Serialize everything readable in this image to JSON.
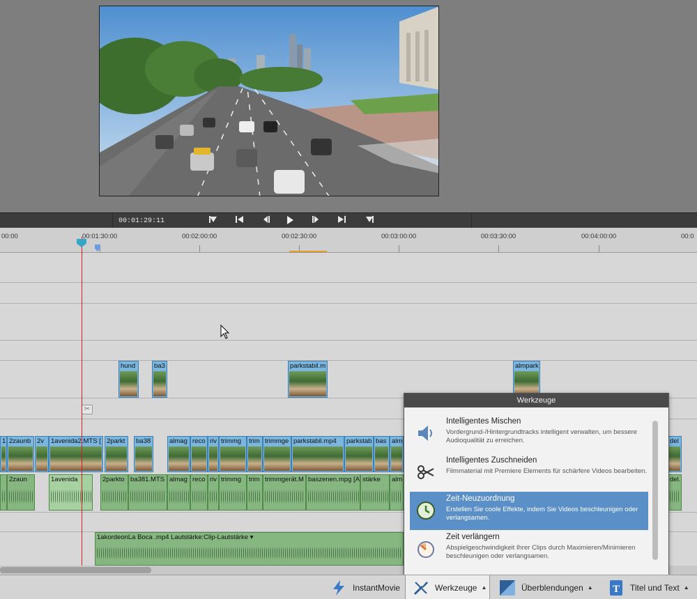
{
  "transport": {
    "timecode": "00:01:29:11",
    "buttons": [
      "mark-in",
      "go-to-start",
      "step-back",
      "play",
      "step-forward",
      "go-to-end",
      "mark-out"
    ]
  },
  "ruler": {
    "labels": [
      "00:00",
      "00:01:30:00",
      "00:02:00:00",
      "00:02:30:00",
      "00:03:00:00",
      "00:03:30:00",
      "00:04:00:00",
      "00:0"
    ]
  },
  "timeline": {
    "upper_video_clips": [
      {
        "label": "hund"
      },
      {
        "label": "ba3"
      },
      {
        "label": "parkstabil.m"
      },
      {
        "label": "almpark"
      }
    ],
    "main_video_clips": [
      {
        "label": "1"
      },
      {
        "label": "2zaunb"
      },
      {
        "label": "2v"
      },
      {
        "label": "1avenida2.MTS ["
      },
      {
        "label": "2parkt"
      },
      {
        "label": "ba38"
      },
      {
        "label": "almag"
      },
      {
        "label": "reco"
      },
      {
        "label": "riv"
      },
      {
        "label": "trimmg"
      },
      {
        "label": "trim"
      },
      {
        "label": "trimmge"
      },
      {
        "label": "parkstabil.mp4"
      },
      {
        "label": "parkstab"
      },
      {
        "label": "bas"
      },
      {
        "label": "almp"
      },
      {
        "label": "del"
      }
    ],
    "main_audio_clips": [
      {
        "label": "2zaun"
      },
      {
        "label": "1avenida"
      },
      {
        "label": "2parkto"
      },
      {
        "label": "ba381.MTS ["
      },
      {
        "label": "almag"
      },
      {
        "label": "reco"
      },
      {
        "label": "riv"
      },
      {
        "label": "trimmg"
      },
      {
        "label": "trim"
      },
      {
        "label": "trimmgerät.M"
      },
      {
        "label": "baszenen.mpg [A]"
      },
      {
        "label": "stärke"
      },
      {
        "label": "alm"
      },
      {
        "label": "del."
      }
    ],
    "music_clip": {
      "label": "1akordeonLa Boca .mp4 Lautstärke:Clip-Lautstärke ▾"
    }
  },
  "panel": {
    "title": "Werkzeuge",
    "items": [
      {
        "title": "Intelligentes Mischen",
        "desc": "Vordergrund-/Hintergrundtracks intelligent verwalten, um bessere Audioqualität zu erreichen.",
        "icon": "speaker-icon",
        "selected": false
      },
      {
        "title": "Intelligentes Zuschneiden",
        "desc": "Filmmaterial mit Premiere Elements für schärfere Videos bearbeiten.",
        "icon": "scissors-icon",
        "selected": false
      },
      {
        "title": "Zeit-Neuzuordnung",
        "desc": "Erstellen Sie coole Effekte, indem Sie Videos beschleunigen oder verlangsamen.",
        "icon": "clock-icon",
        "selected": true
      },
      {
        "title": "Zeit verlängern",
        "desc": "Abspielgeschwindigkeit Ihrer Clips durch Maximieren/Minimieren beschleunigen oder verlangsamen.",
        "icon": "stopwatch-icon",
        "selected": false
      }
    ]
  },
  "bottombar": {
    "instantmovie": "InstantMovie",
    "werkzeuge": "Werkzeuge",
    "ueberblendungen": "Überblendungen",
    "titel": "Titel und Text"
  },
  "colors": {
    "selected": "#5b8fc8",
    "video_clip": "#7ab6de",
    "audio_clip": "#86b780",
    "playhead": "#d02020"
  }
}
